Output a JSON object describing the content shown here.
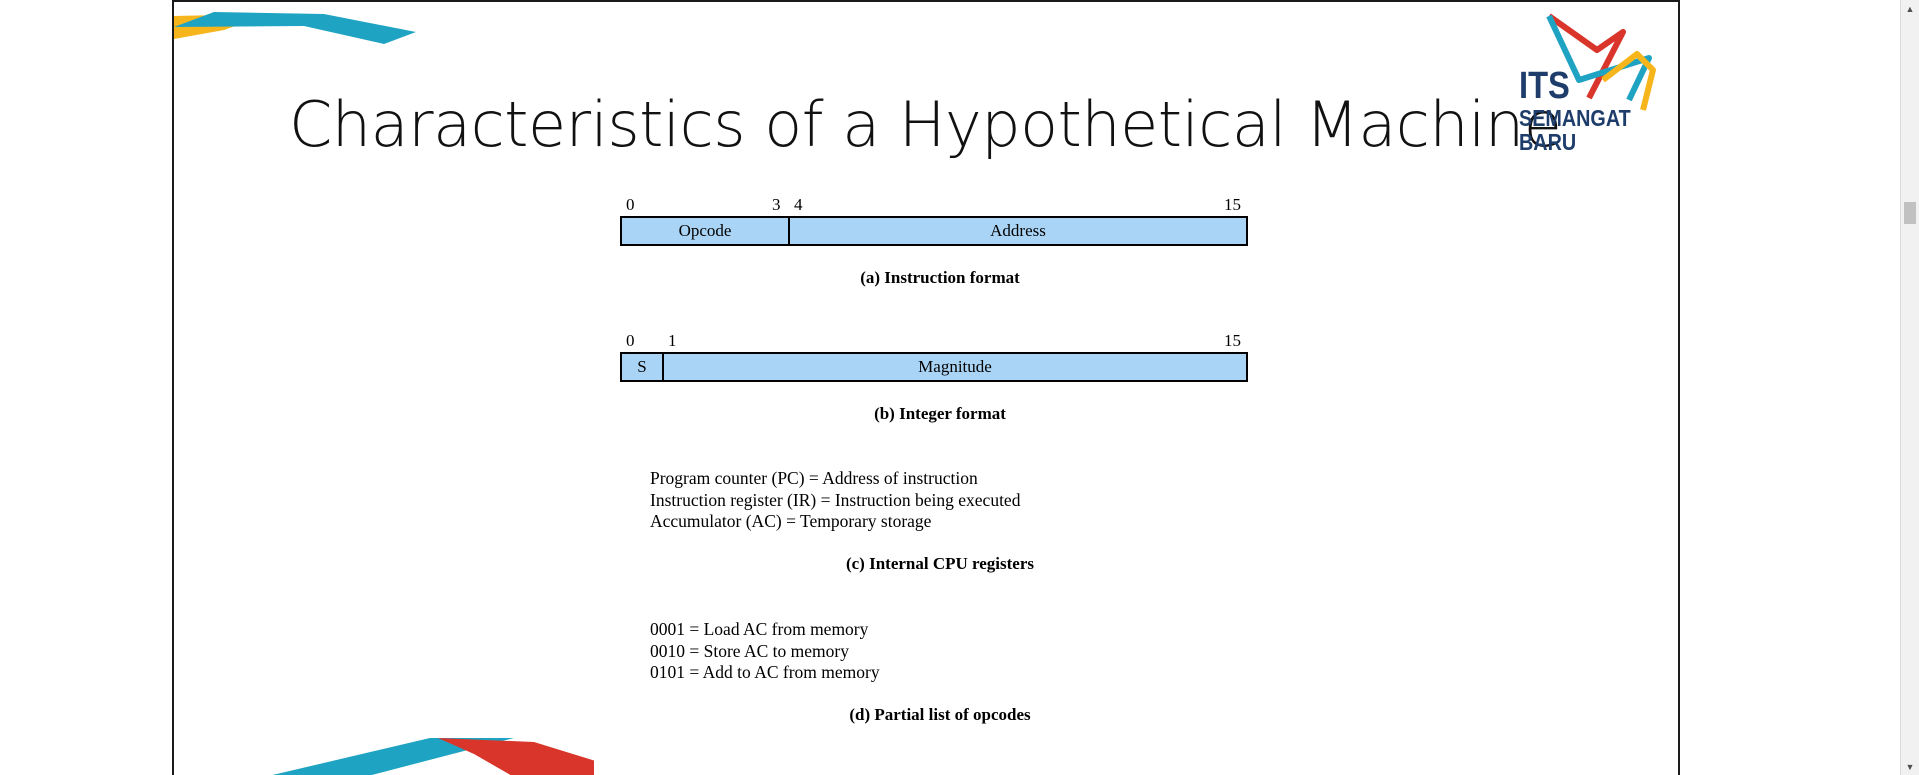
{
  "slide": {
    "title": "Characteristics of a Hypothetical Machine"
  },
  "logo": {
    "line1": "ITS",
    "line2": "SEMANGAT",
    "line3": "BARU",
    "colors": {
      "navy": "#1f3d6b",
      "red": "#d9352a",
      "teal": "#1fa3c2",
      "yellow": "#f5b51b"
    }
  },
  "figure": {
    "instruction_format": {
      "ticks": {
        "start": "0",
        "opcode_end": "3",
        "address_start": "4",
        "end": "15"
      },
      "fields": {
        "opcode": "Opcode",
        "address": "Address"
      },
      "caption": "(a) Instruction format"
    },
    "integer_format": {
      "ticks": {
        "start": "0",
        "magnitude_start": "1",
        "end": "15"
      },
      "fields": {
        "sign": "S",
        "magnitude": "Magnitude"
      },
      "caption": "(b) Integer format"
    },
    "registers": {
      "lines": [
        "Program counter (PC) = Address of instruction",
        "Instruction register (IR) = Instruction being executed",
        "Accumulator (AC) = Temporary storage"
      ],
      "caption": "(c) Internal CPU registers"
    },
    "opcodes": {
      "lines": [
        "0001 = Load AC from memory",
        "0010 = Store AC to memory",
        "0101 = Add to AC from memory"
      ],
      "caption": "(d) Partial list of opcodes"
    },
    "field_fill_color": "#aad4f5"
  },
  "scrollbar": {
    "up_icon": "triangle-up",
    "down_icon": "triangle-down"
  }
}
